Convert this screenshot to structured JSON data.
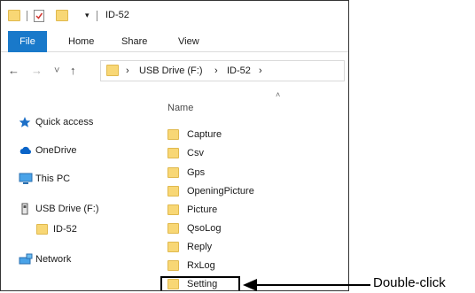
{
  "titlebar": {
    "title": "ID-52",
    "qa_dropdown_glyph": "▾",
    "separator": "|"
  },
  "ribbon": {
    "tabs": [
      {
        "label": "File"
      },
      {
        "label": "Home"
      },
      {
        "label": "Share"
      },
      {
        "label": "View"
      }
    ]
  },
  "nav": {
    "back_glyph": "←",
    "forward_glyph": "→",
    "recent_glyph": "˅",
    "up_glyph": "↑",
    "breadcrumb": [
      "USB Drive (F:)",
      "ID-52"
    ],
    "crumb_separator": "›"
  },
  "sidebar": {
    "items": [
      {
        "label": "Quick access",
        "icon": "star-icon"
      },
      {
        "label": "OneDrive",
        "icon": "cloud-icon"
      },
      {
        "label": "This PC",
        "icon": "monitor-icon"
      },
      {
        "label": "USB Drive (F:)",
        "icon": "usb-drive-icon"
      },
      {
        "label": "ID-52",
        "icon": "folder-icon"
      },
      {
        "label": "Network",
        "icon": "network-icon"
      }
    ]
  },
  "content": {
    "column_name": "Name",
    "sort_glyph": "˄",
    "folders": [
      "Capture",
      "Csv",
      "Gps",
      "OpeningPicture",
      "Picture",
      "QsoLog",
      "Reply",
      "RxLog",
      "Setting"
    ]
  },
  "callout": {
    "text": "Double-click"
  },
  "colors": {
    "file_tab": "#1979ca",
    "folder": "#f8d775",
    "onedrive": "#0a64c8",
    "star": "#1c6fc7"
  }
}
